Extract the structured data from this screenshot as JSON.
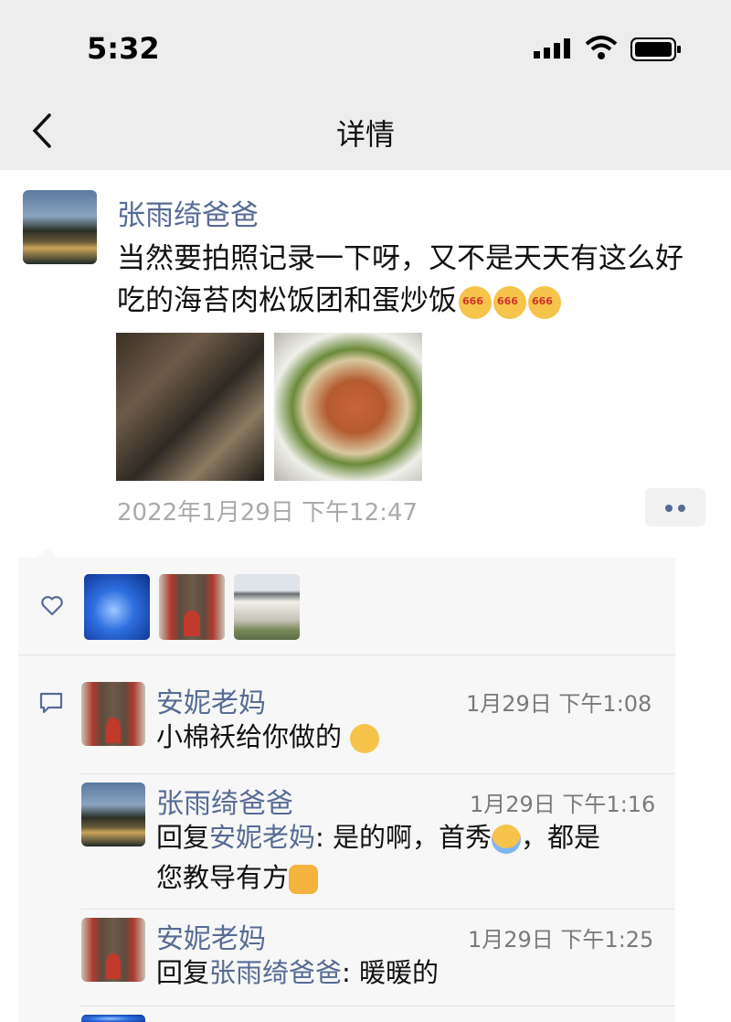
{
  "status_bar": {
    "time": "5:32"
  },
  "nav": {
    "title": "详情"
  },
  "post": {
    "author": "张雨绮爸爸",
    "text": "当然要拍照记录一下呀，又不是天天有这么好吃的海苔肉松饭团和蛋炒饭",
    "timestamp": "2022年1月29日 下午12:47",
    "photos": [
      "photo-dessert-table",
      "photo-fried-rice"
    ]
  },
  "likes": {
    "avatars": [
      "dolphin",
      "family-at-door",
      "house"
    ]
  },
  "comments": [
    {
      "name": "安妮老妈",
      "time": "1月29日 下午1:08",
      "text": "小棉袄给你做的",
      "avatar": "family-at-door"
    },
    {
      "name": "张雨绮爸爸",
      "time": "1月29日 下午1:16",
      "reply_prefix": "回复",
      "reply_to": "安妮老妈",
      "colon": ":",
      "text_a": "是的啊，首秀",
      "text_b": "，都是",
      "text_c": "您教导有方",
      "avatar": "landscape"
    },
    {
      "name": "安妮老妈",
      "time": "1月29日 下午1:25",
      "reply_prefix": "回复",
      "reply_to": "张雨绮爸爸",
      "colon": ":",
      "text": " 暖暖的",
      "avatar": "family-at-door"
    }
  ],
  "colors": {
    "link": "#576b95",
    "nav_bg": "#ededed",
    "panel_bg": "#f7f7f7"
  }
}
